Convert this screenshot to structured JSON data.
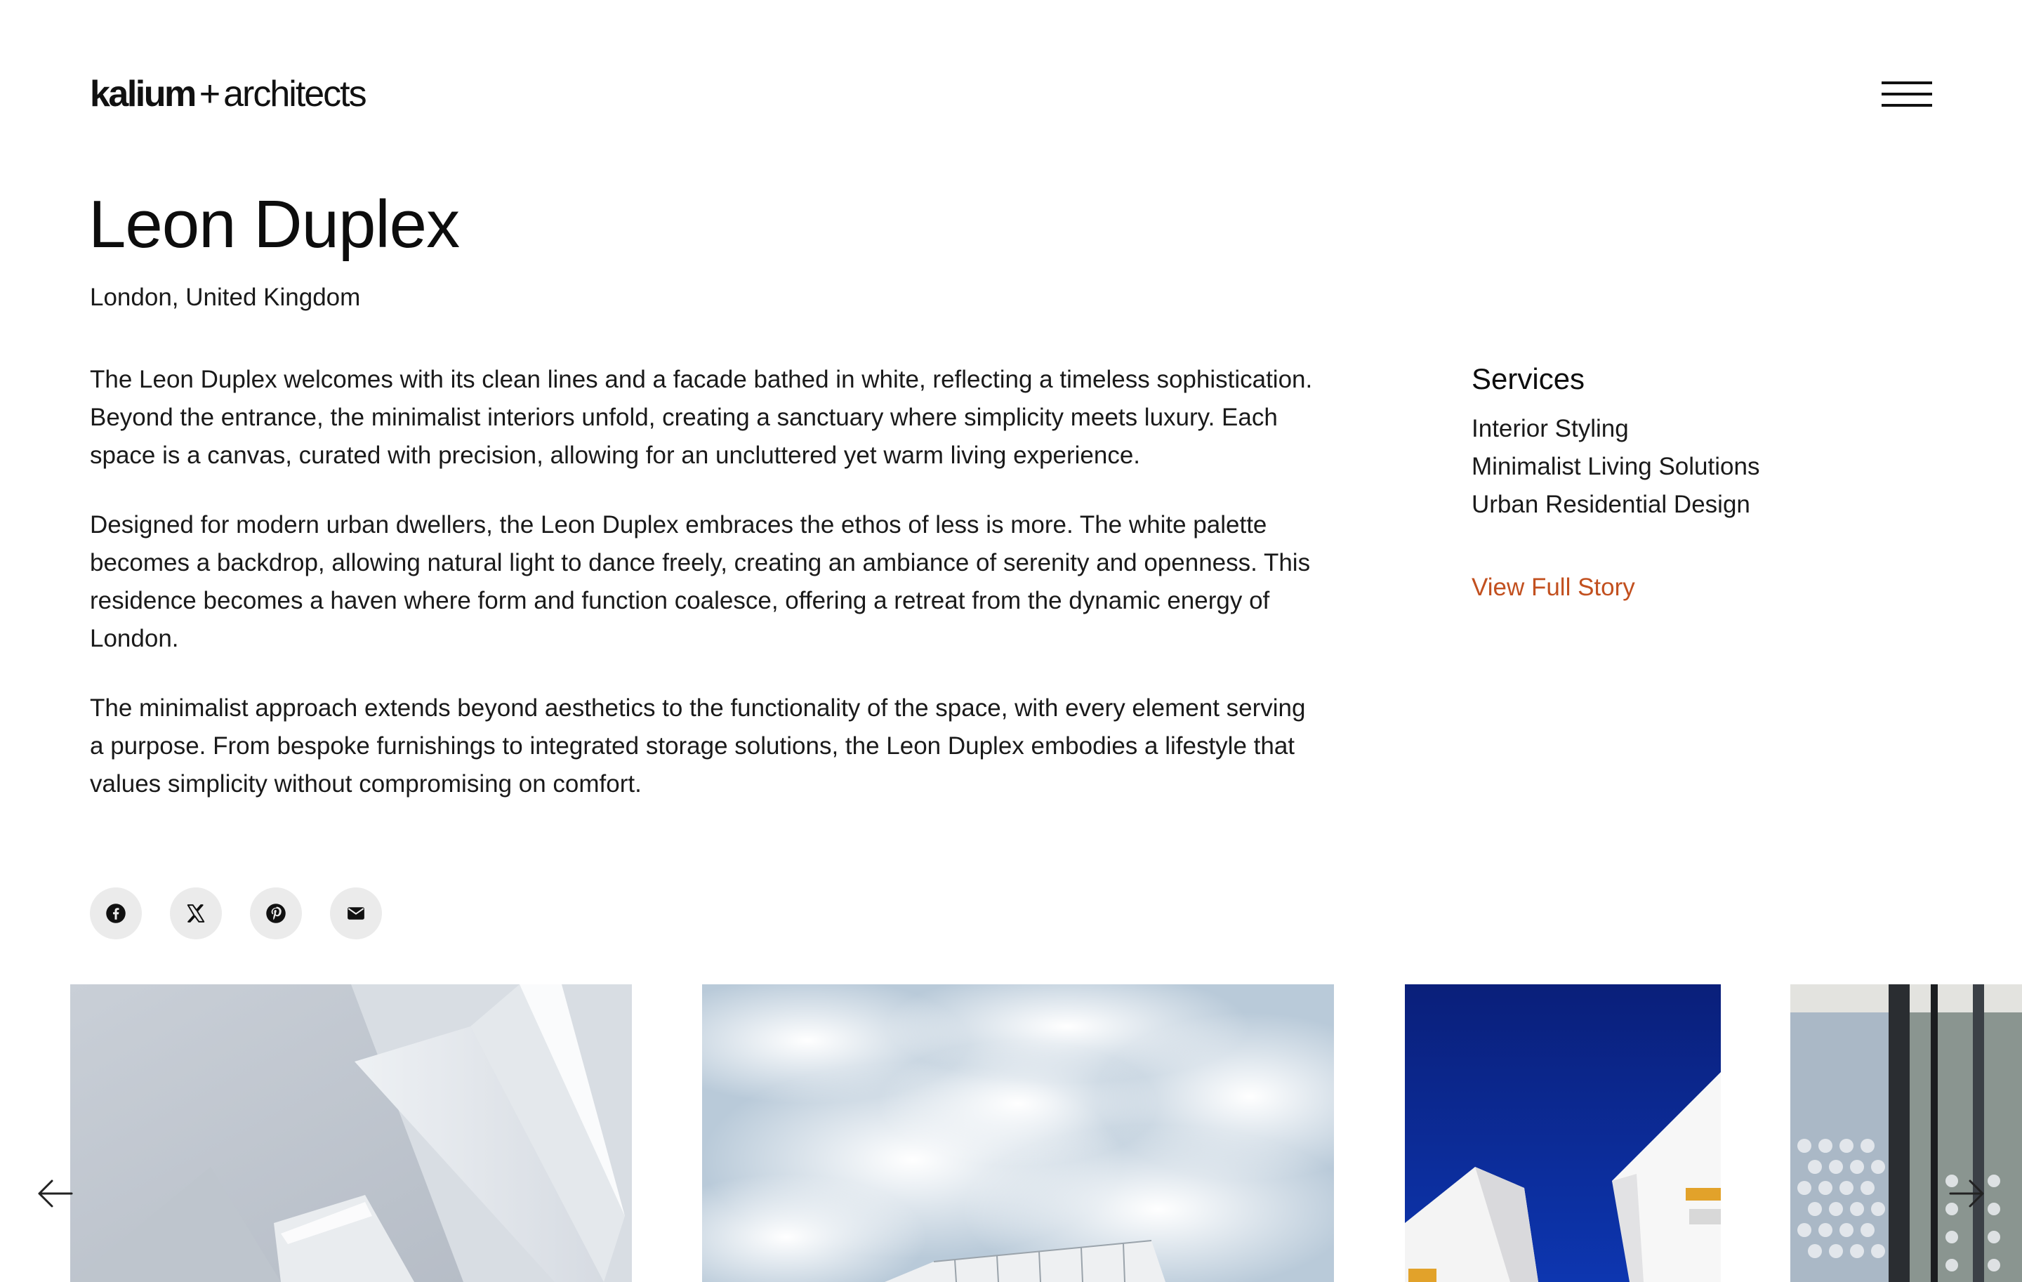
{
  "header": {
    "logo_brand": "kalium",
    "logo_plus": "+",
    "logo_sub": "architects",
    "menu_icon": "hamburger-menu-icon"
  },
  "project": {
    "title": "Leon Duplex",
    "location": "London, United Kingdom",
    "paragraphs": [
      "The Leon Duplex welcomes with its clean lines and a facade bathed in white, reflecting a timeless sophistication. Beyond the entrance, the minimalist interiors unfold, creating a sanctuary where simplicity meets luxury. Each space is a canvas, curated with precision, allowing for an uncluttered yet warm living experience.",
      "Designed for modern urban dwellers, the Leon Duplex embraces the ethos of less is more. The white palette becomes a backdrop, allowing natural light to dance freely, creating an ambiance of serenity and openness. This residence becomes a haven where form and function coalesce, offering a retreat from the dynamic energy of London.",
      "The minimalist approach extends beyond aesthetics to the functionality of the space, with every element serving a purpose. From bespoke furnishings to integrated storage solutions, the Leon Duplex embodies a lifestyle that values simplicity without compromising on comfort."
    ]
  },
  "services": {
    "heading": "Services",
    "items": [
      "Interior Styling",
      "Minimalist Living Solutions",
      "Urban Residential Design"
    ],
    "link_label": "View Full Story"
  },
  "share": {
    "icons": [
      "facebook-icon",
      "x-icon",
      "pinterest-icon",
      "email-icon"
    ]
  },
  "gallery": {
    "images": [
      "white-ceiling-interior",
      "sky-clouds-building",
      "blue-sky-white-building",
      "glass-facade"
    ],
    "prev_icon": "arrow-left-icon",
    "next_icon": "arrow-right-icon"
  },
  "colors": {
    "accent": "#c2501f",
    "text": "#1a1a1a",
    "share_bg": "#ebebeb",
    "sky_blue": "#0b2a8f"
  }
}
